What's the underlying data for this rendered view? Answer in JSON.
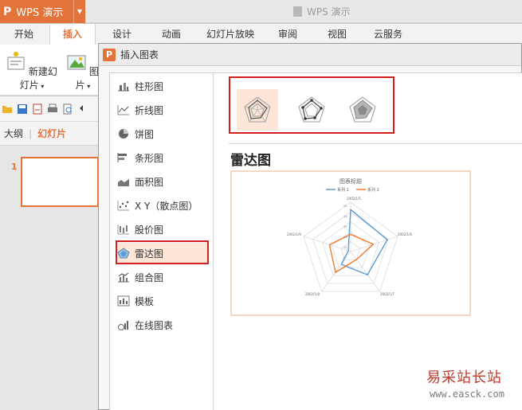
{
  "app": {
    "button_label": "WPS 演示",
    "logo": "P",
    "window_title": "WPS 演示"
  },
  "ribbon": {
    "tabs": [
      "开始",
      "插入",
      "设计",
      "动画",
      "幻灯片放映",
      "审阅",
      "视图",
      "云服务"
    ],
    "active_tab": "插入",
    "buttons": [
      {
        "label": "新建幻灯片",
        "icon": "new-slide-icon"
      },
      {
        "label": "图片",
        "icon": "picture-icon"
      }
    ]
  },
  "left_pane": {
    "tabs": [
      "大纲",
      "幻灯片"
    ],
    "active_tab": "幻灯片",
    "slide_number": "1"
  },
  "dialog": {
    "title": "插入图表",
    "categories": [
      {
        "label": "柱形图",
        "icon": "column-chart-icon"
      },
      {
        "label": "折线图",
        "icon": "line-chart-icon"
      },
      {
        "label": "饼图",
        "icon": "pie-chart-icon"
      },
      {
        "label": "条形图",
        "icon": "bar-chart-icon"
      },
      {
        "label": "面积图",
        "icon": "area-chart-icon"
      },
      {
        "label": "X Y（散点图）",
        "icon": "scatter-chart-icon"
      },
      {
        "label": "股价图",
        "icon": "stock-chart-icon"
      },
      {
        "label": "雷达图",
        "icon": "radar-chart-icon"
      },
      {
        "label": "组合图",
        "icon": "combo-chart-icon"
      },
      {
        "label": "模板",
        "icon": "template-icon"
      },
      {
        "label": "在线图表",
        "icon": "online-chart-icon"
      }
    ],
    "selected_category": "雷达图",
    "subtypes": [
      "radar",
      "radar-with-markers",
      "filled-radar"
    ],
    "selected_subtype": "radar",
    "chart_heading": "雷达图",
    "preview": {
      "title": "图表标题",
      "legend": [
        "系列 1",
        "系列 2"
      ],
      "axis_labels": [
        "2002/1/5",
        "2002/1/6",
        "2002/1/7",
        "2002/1/8",
        "2002/1/9"
      ],
      "ticks": [
        "50",
        "40",
        "30",
        "20",
        "10",
        "0"
      ],
      "series_colors": [
        "#5b9bd5",
        "#ed7d31"
      ]
    }
  },
  "watermark": {
    "line1": "易采站长站",
    "line2": "www.easck.com"
  }
}
